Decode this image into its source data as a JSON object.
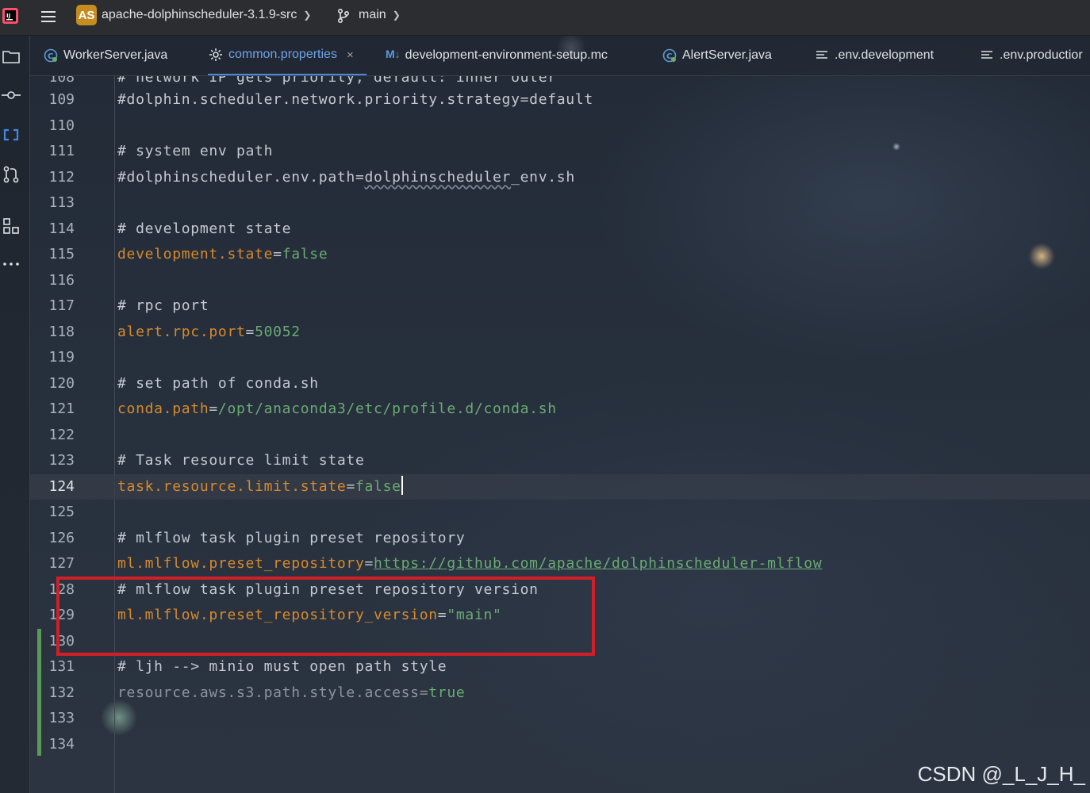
{
  "titlebar": {
    "app_logo_icon": "intellij-idea-icon",
    "menu_icon": "hamburger-menu-icon",
    "project_badge": "AS",
    "project_name": "apache-dolphinscheduler-3.1.9-src",
    "branch_icon": "git-branch-icon",
    "branch_name": "main",
    "accent_badge_color": "#c78c1f"
  },
  "toolstrip": [
    {
      "name": "project-folder-icon"
    },
    {
      "name": "commit-icon"
    },
    {
      "name": "code-brackets-icon"
    },
    {
      "name": "pull-requests-icon"
    },
    {
      "name": "structure-icon"
    },
    {
      "name": "more-icon"
    }
  ],
  "tabs": [
    {
      "label": "WorkerServer.java",
      "icon": "java-class-icon",
      "active": false
    },
    {
      "label": "common.properties",
      "icon": "gear-icon",
      "active": true,
      "close": "×"
    },
    {
      "label": "development-environment-setup.mc",
      "icon": "markdown-icon",
      "icon_text": "M↓",
      "active": false
    },
    {
      "label": "AlertServer.java",
      "icon": "java-class-icon",
      "active": false
    },
    {
      "label": ".env.development",
      "icon": "text-file-icon",
      "active": false
    },
    {
      "label": ".env.productior",
      "icon": "text-file-icon",
      "active": false
    }
  ],
  "editor": {
    "current_line": 124,
    "partial_top_line": {
      "number": "108",
      "text": "# network IP gets priority, default: inner outer"
    },
    "lines": [
      {
        "n": "109",
        "tokens": [
          {
            "t": "#dolphin.scheduler.network.priority.strategy=default",
            "c": "c-comment"
          }
        ]
      },
      {
        "n": "110",
        "tokens": []
      },
      {
        "n": "111",
        "tokens": [
          {
            "t": "# system env path",
            "c": "c-comment"
          }
        ]
      },
      {
        "n": "112",
        "tokens": [
          {
            "t": "#dolphinscheduler.env.path=",
            "c": "c-comment"
          },
          {
            "t": "dolphinscheduler",
            "c": "c-comment squig"
          },
          {
            "t": "_env.sh",
            "c": "c-comment"
          }
        ]
      },
      {
        "n": "113",
        "tokens": []
      },
      {
        "n": "114",
        "tokens": [
          {
            "t": "# development state",
            "c": "c-comment"
          }
        ]
      },
      {
        "n": "115",
        "tokens": [
          {
            "t": "development.state",
            "c": "c-key"
          },
          {
            "t": "=",
            "c": "c-eq"
          },
          {
            "t": "false",
            "c": "c-val"
          }
        ]
      },
      {
        "n": "116",
        "tokens": []
      },
      {
        "n": "117",
        "tokens": [
          {
            "t": "# rpc port",
            "c": "c-comment"
          }
        ]
      },
      {
        "n": "118",
        "tokens": [
          {
            "t": "alert.rpc.port",
            "c": "c-key"
          },
          {
            "t": "=",
            "c": "c-eq"
          },
          {
            "t": "50052",
            "c": "c-val"
          }
        ]
      },
      {
        "n": "119",
        "tokens": []
      },
      {
        "n": "120",
        "tokens": [
          {
            "t": "# set path of conda.sh",
            "c": "c-comment"
          }
        ]
      },
      {
        "n": "121",
        "tokens": [
          {
            "t": "conda.path",
            "c": "c-key"
          },
          {
            "t": "=",
            "c": "c-eq"
          },
          {
            "t": "/opt/anaconda3/etc/profile.d/conda.sh",
            "c": "c-val"
          }
        ]
      },
      {
        "n": "122",
        "tokens": []
      },
      {
        "n": "123",
        "tokens": [
          {
            "t": "# Task resource limit state",
            "c": "c-comment"
          }
        ]
      },
      {
        "n": "124",
        "tokens": [
          {
            "t": "task.resource.limit.state",
            "c": "c-key"
          },
          {
            "t": "=",
            "c": "c-eq"
          },
          {
            "t": "false",
            "c": "c-val"
          }
        ],
        "caret": true
      },
      {
        "n": "125",
        "tokens": []
      },
      {
        "n": "126",
        "tokens": [
          {
            "t": "# mlflow task plugin preset repository",
            "c": "c-comment"
          }
        ]
      },
      {
        "n": "127",
        "tokens": [
          {
            "t": "ml.mlflow.preset_repository",
            "c": "c-key"
          },
          {
            "t": "=",
            "c": "c-eq"
          },
          {
            "t": "https://github.com/apache/dolphinscheduler-mlflow",
            "c": "c-url"
          }
        ]
      },
      {
        "n": "128",
        "tokens": [
          {
            "t": "# mlflow task plugin preset repository version",
            "c": "c-comment"
          }
        ]
      },
      {
        "n": "129",
        "tokens": [
          {
            "t": "ml.mlflow.preset_repository_version",
            "c": "c-key"
          },
          {
            "t": "=",
            "c": "c-eq"
          },
          {
            "t": "\"main\"",
            "c": "c-val"
          }
        ]
      },
      {
        "n": "130",
        "tokens": []
      },
      {
        "n": "131",
        "tokens": [
          {
            "t": "# ljh --> minio must open path style",
            "c": "c-comment"
          }
        ]
      },
      {
        "n": "132",
        "tokens": [
          {
            "t": "resource.aws.s3.path.style.access",
            "c": "c-dim"
          },
          {
            "t": "=",
            "c": "c-dim"
          },
          {
            "t": "true",
            "c": "c-val"
          }
        ]
      },
      {
        "n": "133",
        "tokens": []
      },
      {
        "n": "134",
        "tokens": []
      }
    ]
  },
  "colors": {
    "key": "#d68a2c",
    "value": "#6aab73",
    "comment": "#c5c9d0",
    "annotation_box": "#d01f27",
    "vcs_added": "#5a9a56"
  },
  "watermark": "CSDN @_L_J_H_"
}
